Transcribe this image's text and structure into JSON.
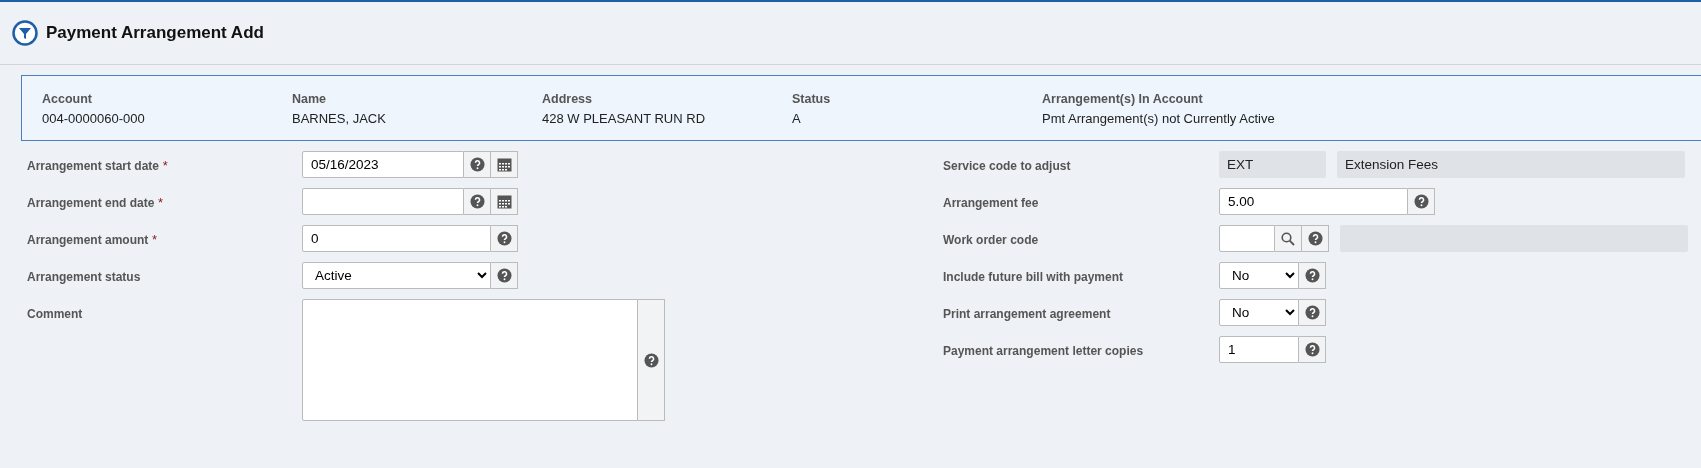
{
  "page": {
    "title": "Payment Arrangement Add"
  },
  "account_info": [
    {
      "label": "Account",
      "value": "004-0000060-000"
    },
    {
      "label": "Name",
      "value": "BARNES, JACK"
    },
    {
      "label": "Address",
      "value": "428 W PLEASANT RUN RD"
    },
    {
      "label": "Status",
      "value": "A"
    },
    {
      "label": "Arrangement(s) In Account",
      "value": "Pmt Arrangement(s) not Currently Active"
    }
  ],
  "left_fields": [
    {
      "kind": "date",
      "label": "Arrangement start date",
      "required_mark": "*",
      "value": "05/16/2023"
    },
    {
      "kind": "date",
      "label": "Arrangement end date",
      "required_mark": "*"
    },
    {
      "kind": "text",
      "label": "Arrangement amount",
      "required_mark": "*",
      "value": "0"
    },
    {
      "kind": "select",
      "label": "Arrangement status",
      "value": "Active"
    },
    {
      "kind": "textarea",
      "label": "Comment"
    }
  ],
  "right_fields": [
    {
      "kind": "readonly",
      "label": "Service code to adjust",
      "value": "EXT",
      "description": "Extension Fees"
    },
    {
      "kind": "text",
      "label": "Arrangement fee",
      "value": "5.00"
    },
    {
      "kind": "lookup",
      "label": "Work order code"
    },
    {
      "kind": "select",
      "label": "Include future bill with payment",
      "value": "No"
    },
    {
      "kind": "select",
      "label": "Print arrangement agreement",
      "value": "No"
    },
    {
      "kind": "text",
      "label": "Payment arrangement letter copies",
      "value": "1"
    }
  ]
}
